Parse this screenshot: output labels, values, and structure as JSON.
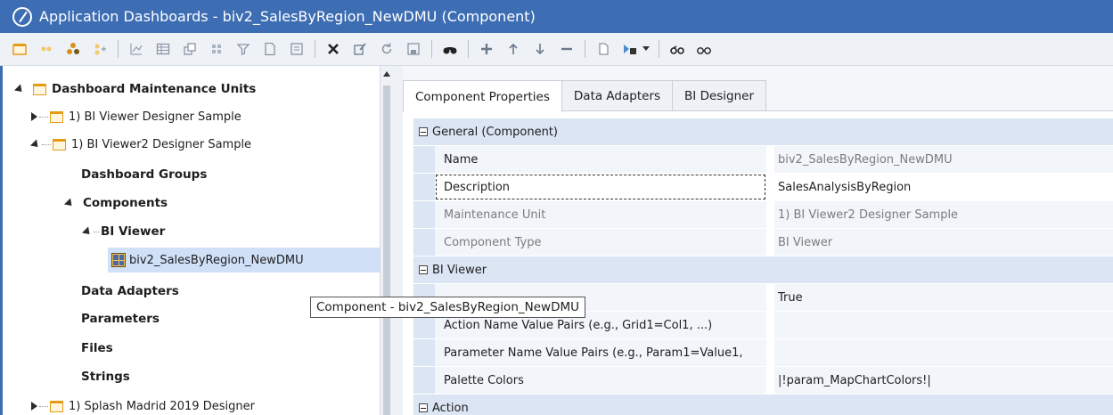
{
  "window": {
    "title": "Application Dashboards - biv2_SalesByRegion_NewDMU (Component)",
    "logo_icon": "onestream-logo-icon",
    "title_bar_color": "#3d6db3"
  },
  "toolbar": {
    "icons": [
      "dashboard-unit-icon",
      "group-icon",
      "component-icon",
      "adapter-icon",
      "chart-icon",
      "grid-icon",
      "parameter-icon",
      "filter-icon",
      "funnel-icon",
      "file-icon",
      "strings-icon",
      "delete-icon",
      "rename-icon",
      "refresh-icon",
      "save-icon",
      "search-icon",
      "add-icon",
      "move-up-icon",
      "move-down-icon",
      "remove-icon",
      "copy-icon",
      "run-icon",
      "dropdown-arrow-icon",
      "object-lookup-icon",
      "view-icon"
    ]
  },
  "tree": {
    "root": "Dashboard Maintenance Units",
    "items": [
      {
        "label": "1) BI Viewer Designer Sample"
      },
      {
        "label": "1) BI Viewer2 Designer Sample"
      },
      {
        "label": "Dashboard Groups"
      },
      {
        "label": "Components"
      },
      {
        "label": "BI Viewer"
      },
      {
        "label": "biv2_SalesByRegion_NewDMU"
      },
      {
        "label": "Data Adapters"
      },
      {
        "label": "Parameters"
      },
      {
        "label": "Files"
      },
      {
        "label": "Strings"
      },
      {
        "label": "1) Splash Madrid 2019 Designer"
      }
    ]
  },
  "tabs": [
    {
      "label": "Component Properties"
    },
    {
      "label": "Data Adapters"
    },
    {
      "label": "BI Designer"
    }
  ],
  "properties": {
    "general_header": "General (Component)",
    "rows": [
      {
        "key": "Name",
        "value": "biv2_SalesByRegion_NewDMU"
      },
      {
        "key": "Description",
        "value": "SalesAnalysisByRegion"
      },
      {
        "key": "Maintenance Unit",
        "value": "1) BI Viewer2 Designer Sample"
      },
      {
        "key": "Component Type",
        "value": "BI Viewer"
      }
    ],
    "bi_header": "BI Viewer",
    "bi_rows": [
      {
        "key": "",
        "value": "True"
      },
      {
        "key": "Action Name Value Pairs (e.g., Grid1=Col1, ...)",
        "value": ""
      },
      {
        "key": "Parameter Name Value Pairs (e.g., Param1=Value1,",
        "value": ""
      },
      {
        "key": "Palette Colors",
        "value": "|!param_MapChartColors!|"
      }
    ],
    "action_header": "Action"
  },
  "tooltip": "Component - biv2_SalesByRegion_NewDMU"
}
